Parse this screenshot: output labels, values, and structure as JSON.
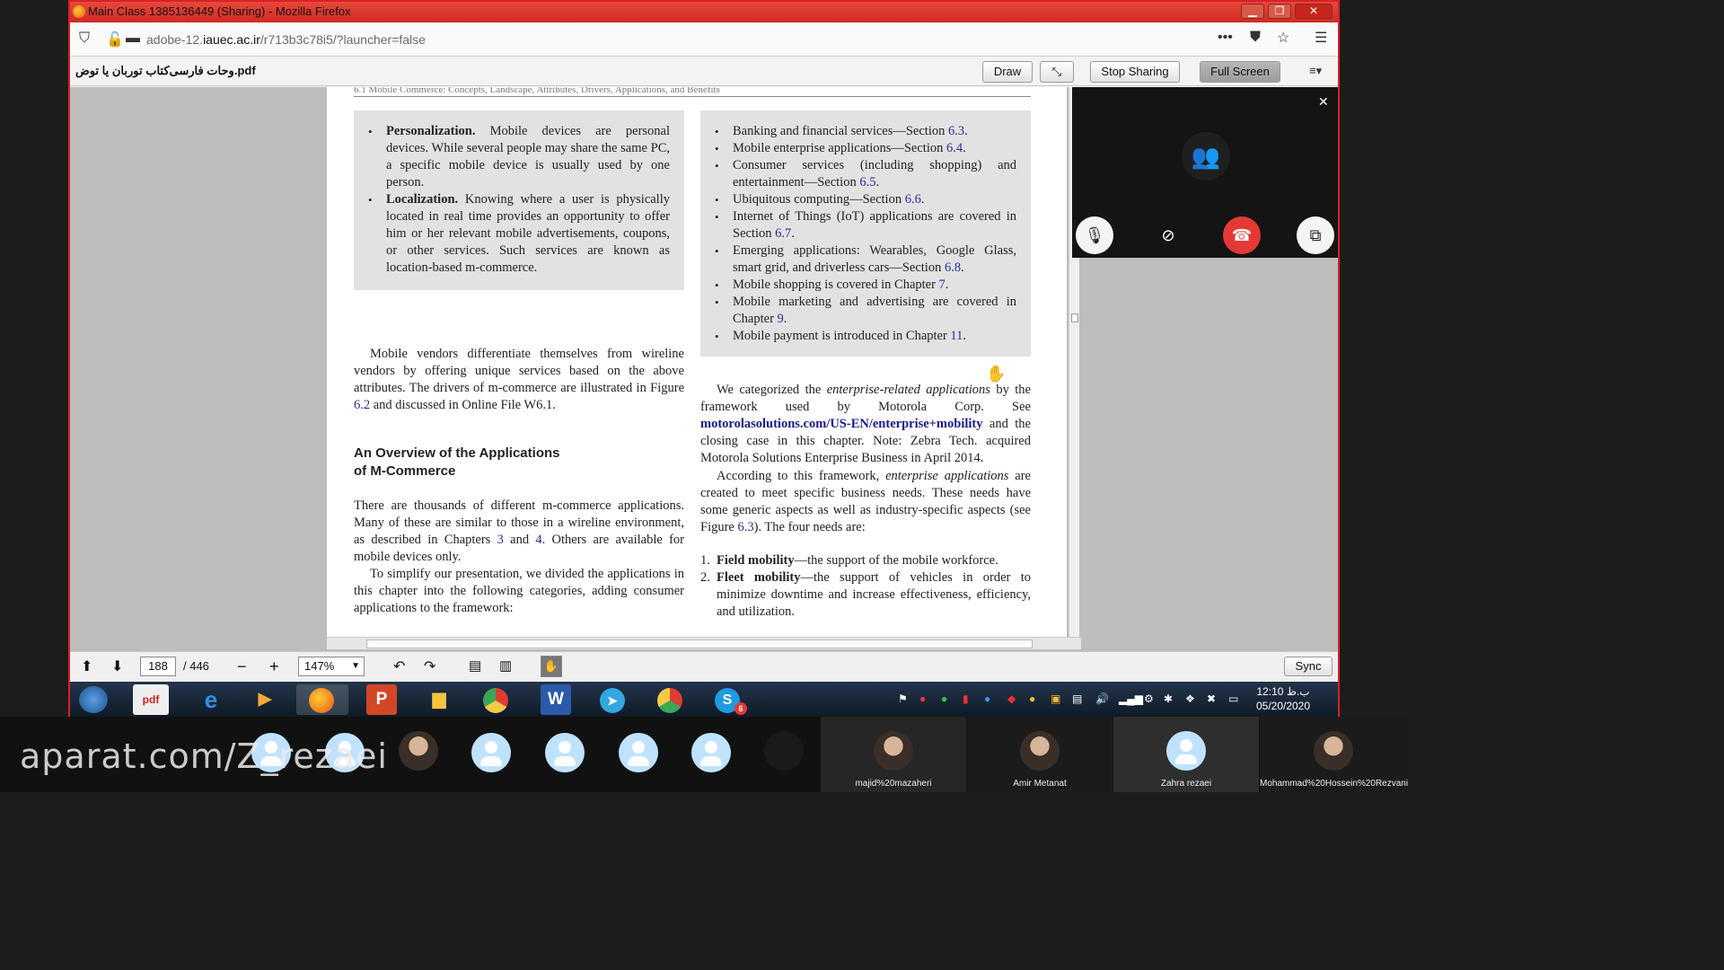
{
  "window": {
    "title": "Main Class 1385136449 (Sharing) - Mozilla Firefox",
    "controls": [
      "minimize",
      "restore",
      "close"
    ]
  },
  "browser": {
    "url_prefix": "adobe-12.",
    "url_domain": "iauec.ac.ir",
    "url_path": "/r713b3c78i5/?launcher=false",
    "icons": [
      "shield-icon",
      "insecure-lock-icon",
      "page-icon",
      "more-icon",
      "pocket-icon",
      "bookmark-star-icon",
      "menu-icon"
    ]
  },
  "pdf_toolbar": {
    "filename": "وحات فارسی‌کتاب توربان یا توض.pdf",
    "draw_label": "Draw",
    "stop_sharing_label": "Stop Sharing",
    "full_screen_label": "Full Screen"
  },
  "document": {
    "running_header": "6.1   Mobile Commerce: Concepts, Landscape, Attributes, Drivers, Applications, and Benefits",
    "left_box": [
      {
        "term": "Personalization.",
        "text": " Mobile devices are personal devices. While several people may share the same PC, a specific mobile device is usually used by one person."
      },
      {
        "term": "Localization.",
        "text": " Knowing where a user is physically located in real time provides an opportunity to offer him or her relevant mobile advertisements, coupons, or other services. Such services are known as location-based m-commerce."
      }
    ],
    "right_box": [
      {
        "text": "Banking and financial services—Section ",
        "ref": "6.3",
        "tail": "."
      },
      {
        "text": "Mobile enterprise applications—Section ",
        "ref": "6.4",
        "tail": "."
      },
      {
        "text": "Consumer services (including shopping) and entertainment—Section ",
        "ref": "6.5",
        "tail": "."
      },
      {
        "text": "Ubiquitous computing—Section ",
        "ref": "6.6",
        "tail": "."
      },
      {
        "text": "Internet of Things (IoT) applications are covered in Section ",
        "ref": "6.7",
        "tail": "."
      },
      {
        "text": "Emerging applications: Wearables, Google Glass, smart grid, and driverless cars—Section ",
        "ref": "6.8",
        "tail": "."
      },
      {
        "text": "Mobile shopping is covered in Chapter ",
        "ref": "7",
        "tail": "."
      },
      {
        "text": "Mobile marketing and advertising are covered in Chapter ",
        "ref": "9",
        "tail": "."
      },
      {
        "text": "Mobile payment is introduced in Chapter ",
        "ref": "11",
        "tail": "."
      }
    ],
    "vendors_par": {
      "text": "Mobile vendors differentiate themselves from wireline vendors by offering unique services based on the above attributes. The drivers of m-commerce are illustrated in Figure ",
      "ref": "6.2",
      "tail": " and discussed in Online File W6.1."
    },
    "section_heading_line1": "An Overview of the Applications",
    "section_heading_line2": "of M-Commerce",
    "thousands_par": {
      "a": "There are thousands of different m-commerce applications. Many of these are similar to those in a wireline environment, as described in Chapters ",
      "ref1": "3",
      "b": " and ",
      "ref2": "4",
      "c": ". Others are available for mobile devices only."
    },
    "simplify_par": "To simplify our presentation, we divided the applications in this chapter into the following categories, adding consumer applications to the framework:",
    "categorized_par": {
      "a": "We categorized the ",
      "em": "enterprise-related applications",
      "b": " by the framework used by Motorola Corp. See ",
      "link": "motorolasolutions.com/US-EN/enterprise+mobility",
      "c": " and the closing case in this chapter. Note: Zebra Tech. acquired Motorola Solutions Enterprise Business in April 2014."
    },
    "according_par": {
      "a": "According to this framework, ",
      "em": "enterprise applications",
      "b": " are created to meet specific business needs. These needs have some generic aspects as well as industry-specific aspects (see Figure ",
      "ref": "6.3",
      "c": "). The four needs are:"
    },
    "needs": [
      {
        "num": "1.",
        "term": "Field mobility",
        "text": "—the support of the mobile workforce."
      },
      {
        "num": "2.",
        "term": "Fleet mobility",
        "text": "—the support of vehicles in order to minimize downtime and increase effectiveness, efficiency, and utilization."
      }
    ]
  },
  "video_panel": {
    "icons": [
      "close-icon",
      "participants-icon",
      "microphone-icon",
      "camera-off-icon",
      "hang-up-icon",
      "popout-icon"
    ],
    "hangup_color": "#e53935"
  },
  "nav_bar": {
    "page_current": "188",
    "page_total": "/ 446",
    "zoom": "147%",
    "sync_label": "Sync"
  },
  "taskbar": {
    "apps": [
      "start",
      "img2pdf",
      "internet-explorer",
      "media-player",
      "firefox",
      "powerpoint",
      "file-explorer",
      "chrome",
      "word",
      "telegram",
      "chrome-2",
      "skype"
    ],
    "clock_time": "12:10 ب.ظ",
    "clock_date": "05/20/2020",
    "skype_badge": "6"
  },
  "participants": {
    "watermark": "aparat.com/Z_rezaei",
    "names": [
      "majid%20mazaheri",
      "Amir Metanat",
      "Zahra rezaei",
      "Mohammad%20Hossein%20Rezvani"
    ]
  }
}
